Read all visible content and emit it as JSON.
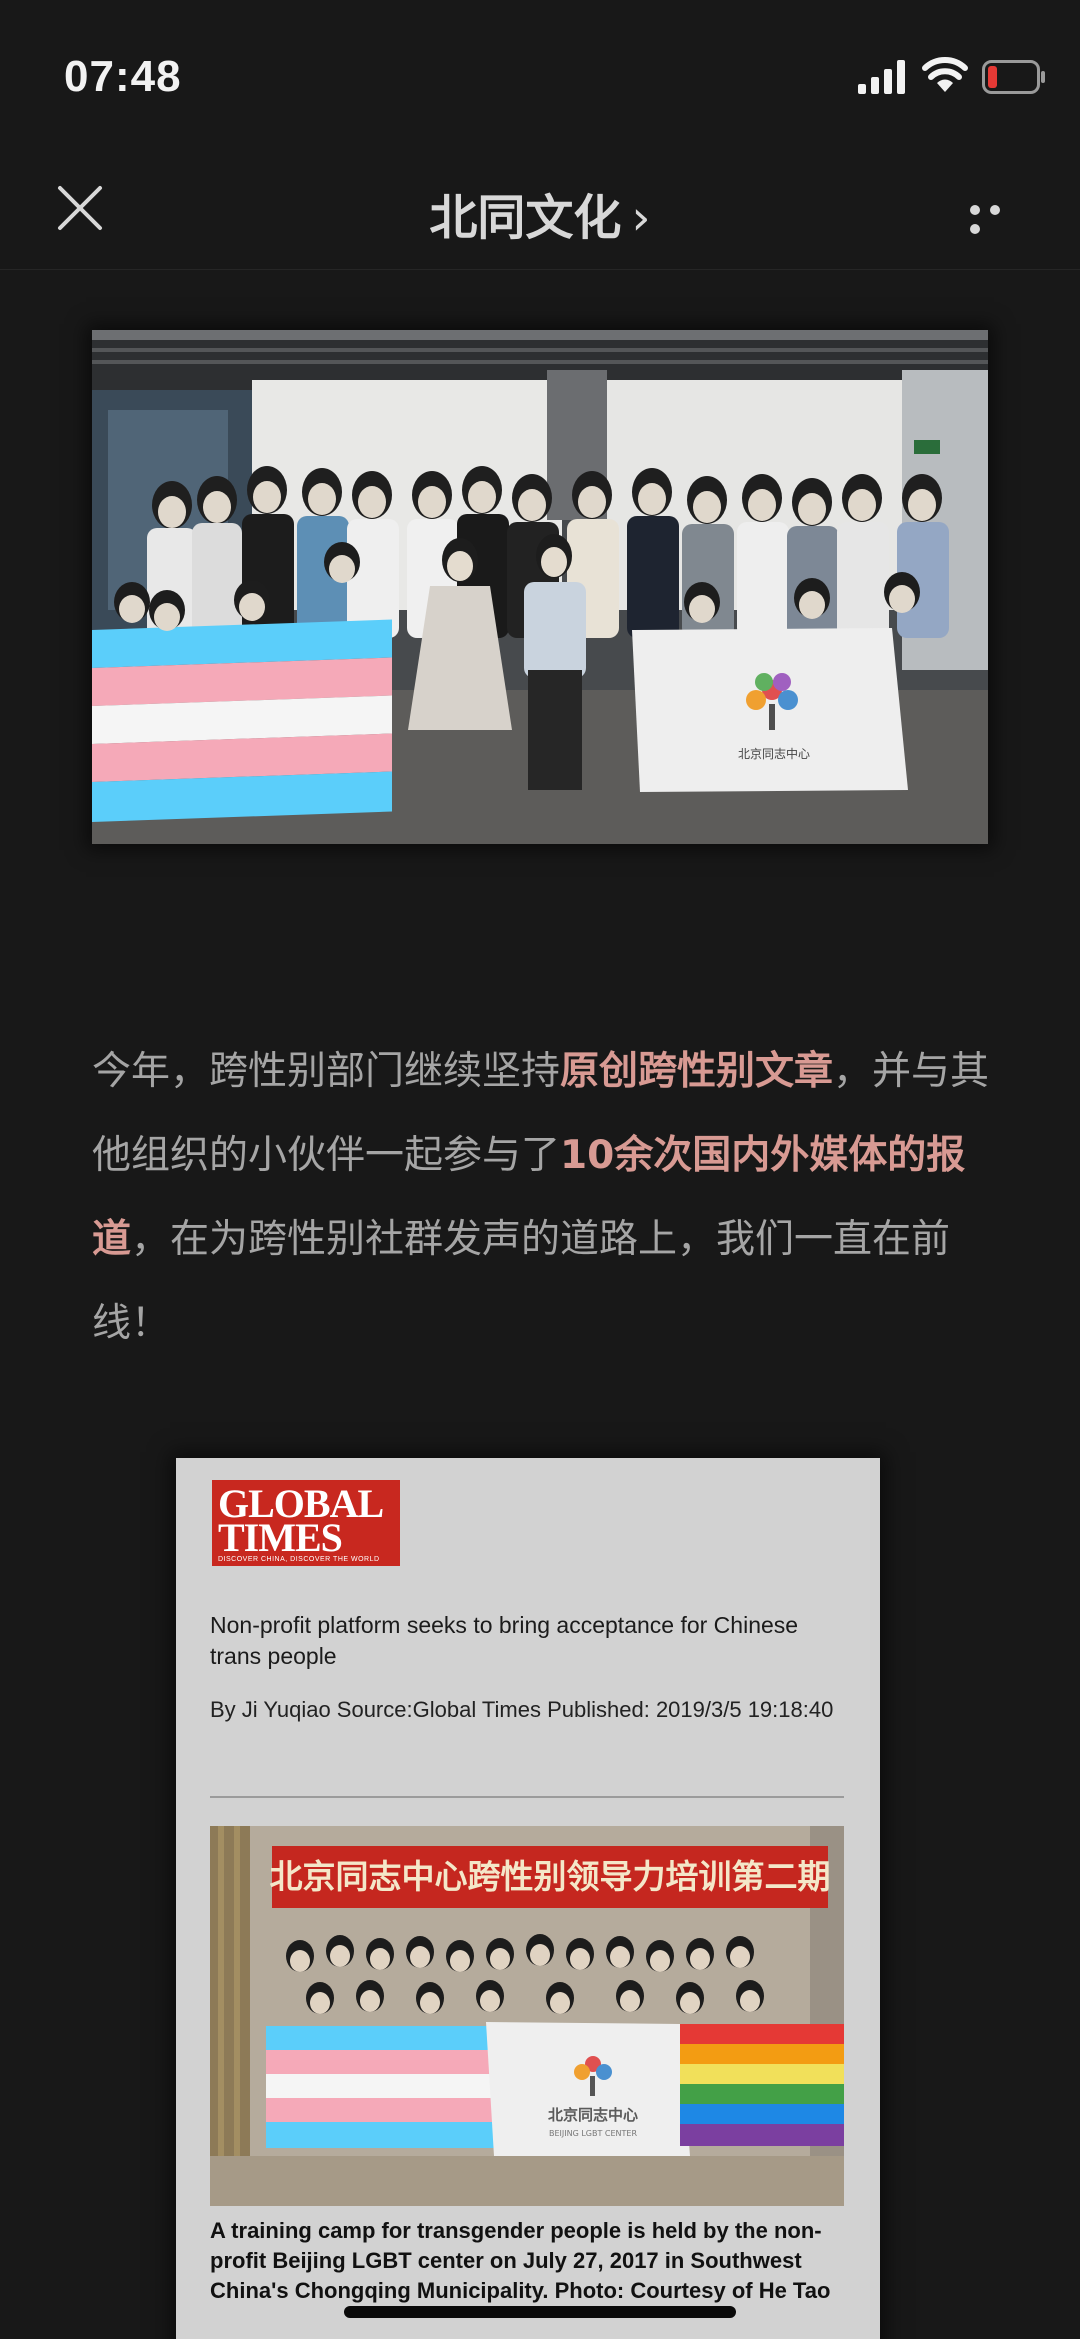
{
  "status_bar": {
    "time": "07:48",
    "icons": [
      "signal-icon",
      "wifi-icon",
      "battery-low-icon"
    ],
    "battery_color": "#e53935"
  },
  "nav": {
    "title": "北同文化",
    "chevron": "›",
    "icons": [
      "close-icon",
      "more-icon"
    ]
  },
  "photo1": {
    "flag_text": "北京同志中心"
  },
  "paragraph": {
    "p1": "今年，跨性别部门继续坚持",
    "h1": "原创跨性别文章",
    "p2": "，并与其他组织的小伙伴一起参与了",
    "h2": "10余次国内外媒体的报道",
    "p3": "，在为跨性别社群发声的道路上，我们一直在前线！"
  },
  "article_card": {
    "logo_line1": "GLOBAL",
    "logo_line2": "TIMES",
    "logo_tagline": "DISCOVER CHINA, DISCOVER THE WORLD",
    "headline": "Non-profit platform seeks to bring acceptance for Chinese trans people",
    "byline": "By Ji Yuqiao Source:Global Times Published: 2019/3/5 19:18:40",
    "banner_text": "北京同志中心跨性别领导力培训第二期",
    "flag_text": "北京同志中心",
    "flag_subtext": "BEIJING LGBT CENTER",
    "caption": "A training camp for transgender people is held by the non-profit Beijing LGBT center on July 27, 2017 in Southwest China's Chongqing Municipality. Photo: Courtesy of He Tao"
  },
  "colors": {
    "background": "#181818",
    "highlight": "#d89a93",
    "body_text": "#a5a5a5",
    "trans_blue": "#5bcefa",
    "trans_pink": "#f5a9b8"
  }
}
